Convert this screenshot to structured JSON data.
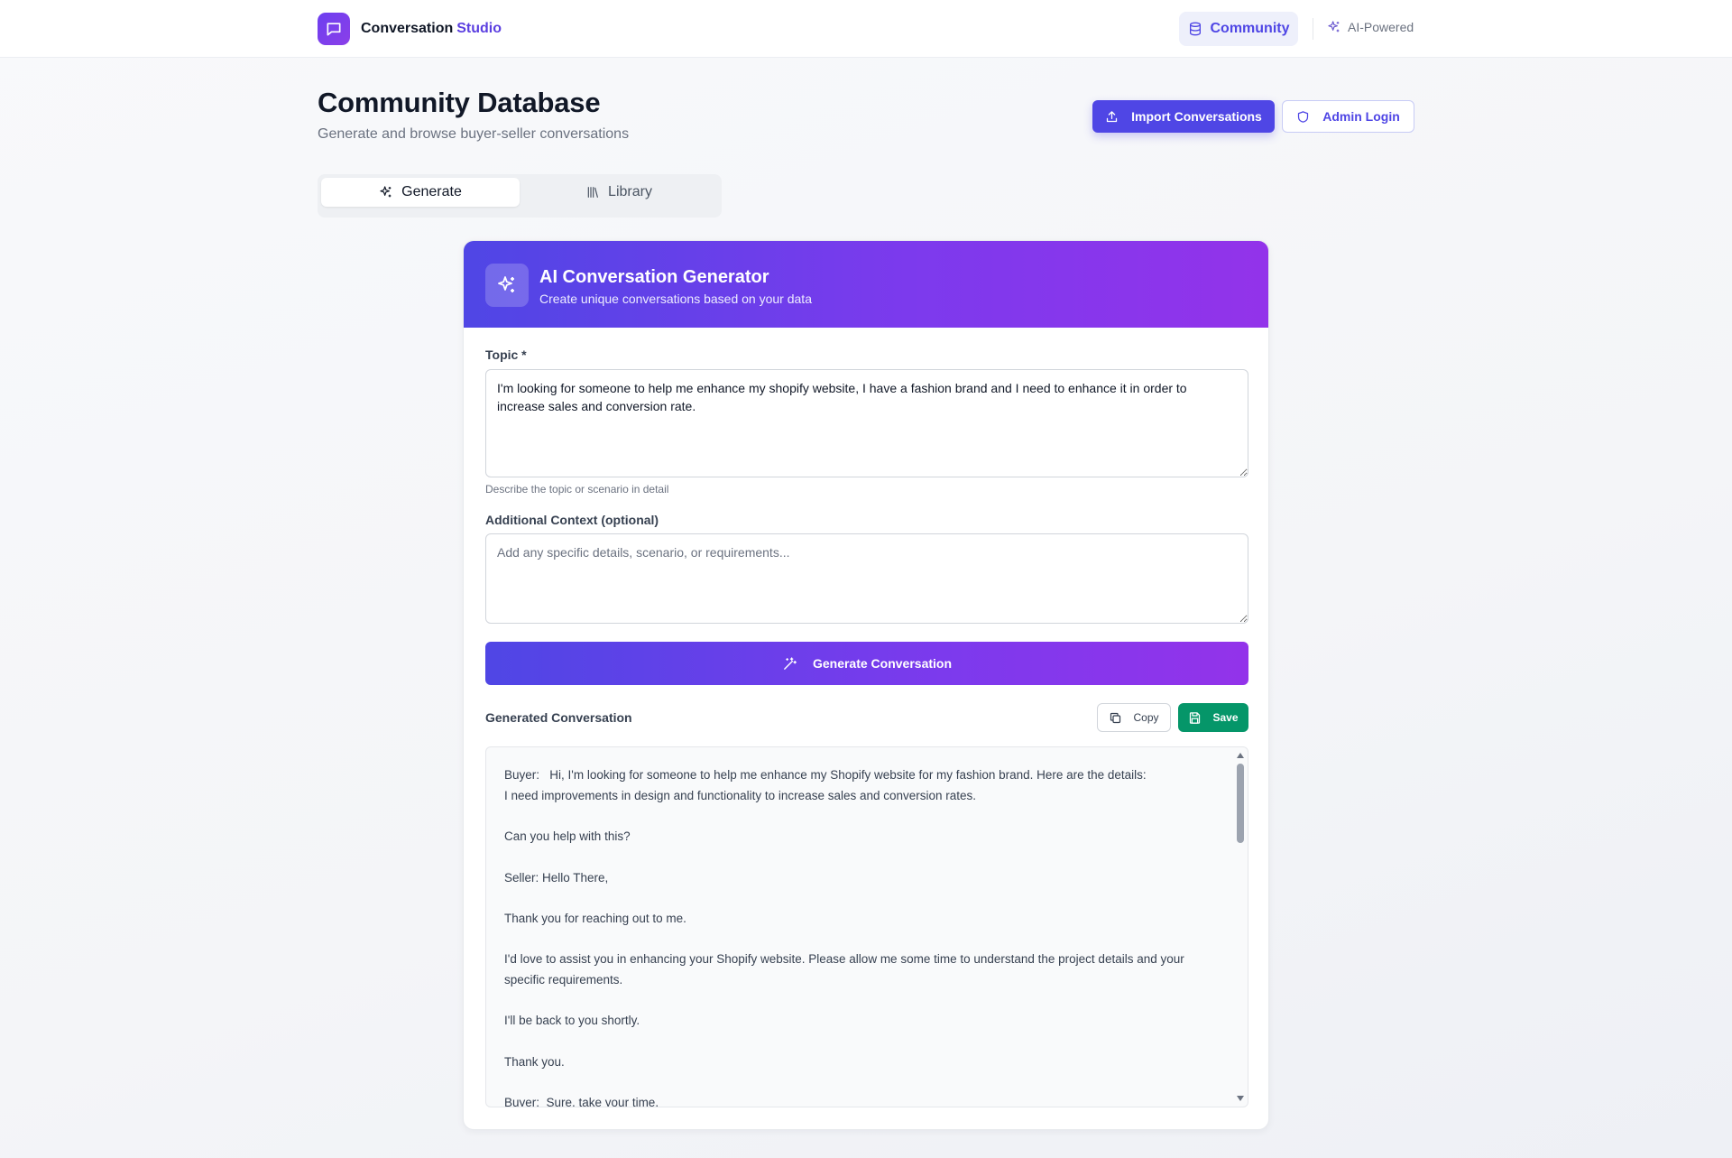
{
  "header": {
    "brand_name": "Conversation",
    "brand_accent": "Studio",
    "nav_community": "Community",
    "nav_ai": "AI-Powered"
  },
  "page": {
    "title": "Community Database",
    "subtitle": "Generate and browse buyer-seller conversations",
    "import_label": "Import Conversations",
    "admin_label": "Admin Login"
  },
  "tabs": [
    {
      "label": "Generate",
      "active": true
    },
    {
      "label": "Library",
      "active": false
    }
  ],
  "generator": {
    "title": "AI Conversation Generator",
    "subtitle": "Create unique conversations based on your data",
    "topic_label": "Topic *",
    "topic_value": "I'm looking for someone to help me enhance my shopify website, I have a fashion brand and I need to enhance it in order to increase sales and conversion rate.",
    "topic_hint": "Describe the topic or scenario in detail",
    "context_label": "Additional Context (optional)",
    "context_placeholder": "Add any specific details, scenario, or requirements...",
    "generate_label": "Generate Conversation",
    "output_label": "Generated Conversation",
    "copy_label": "Copy",
    "save_label": "Save",
    "conversation": "Buyer:   Hi, I'm looking for someone to help me enhance my Shopify website for my fashion brand. Here are the details:\nI need improvements in design and functionality to increase sales and conversion rates.\n\nCan you help with this?\n\nSeller: Hello There,\n\nThank you for reaching out to me.\n\nI'd love to assist you in enhancing your Shopify website. Please allow me some time to understand the project details and your specific requirements.\n\nI'll be back to you shortly.\n\nThank you.\n\nBuyer:  Sure, take your time."
  },
  "colors": {
    "accent": "#4f46e5",
    "accent_purple": "#9333ea",
    "save_green": "#059669"
  },
  "icons": {
    "brand": "chat-bubble-icon",
    "community": "database-icon",
    "ai": "sparkles-icon",
    "import": "upload-icon",
    "admin": "shield-icon",
    "library": "library-icon",
    "generate": "magic-wand-icon",
    "copy": "copy-icon",
    "save": "save-icon"
  }
}
